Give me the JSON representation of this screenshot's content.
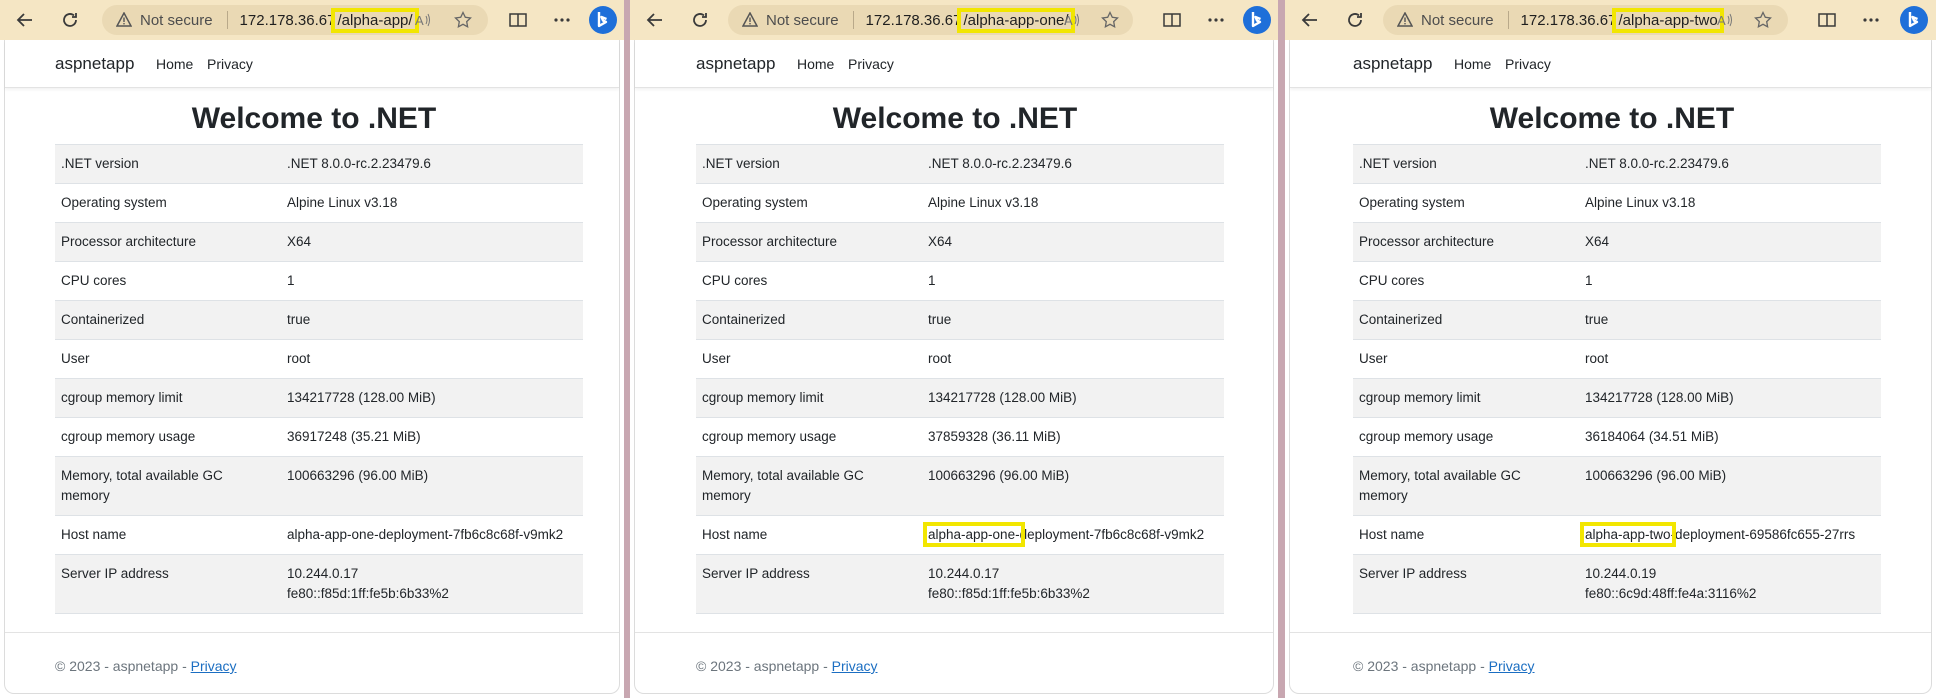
{
  "browser": {
    "not_secure": "Not secure",
    "windows": [
      {
        "host": "172.178.36.67",
        "path": "/alpha-app/"
      },
      {
        "host": "172.178.36.67",
        "path": "/alpha-app-one/"
      },
      {
        "host": "172.178.36.67",
        "path": "/alpha-app-two"
      }
    ]
  },
  "app": {
    "brand": "aspnetapp",
    "nav": [
      "Home",
      "Privacy"
    ],
    "title": "Welcome to .NET",
    "footer_prefix": "© 2023 - aspnetapp - ",
    "footer_link": "Privacy"
  },
  "labels": [
    ".NET version",
    "Operating system",
    "Processor architecture",
    "CPU cores",
    "Containerized",
    "User",
    "cgroup memory limit",
    "cgroup memory usage",
    "Memory, total available GC memory",
    "Host name",
    "Server IP address"
  ],
  "pages": [
    {
      "values": [
        ".NET 8.0.0-rc.2.23479.6",
        "Alpine Linux v3.18",
        "X64",
        "1",
        "true",
        "root",
        "134217728 (128.00 MiB)",
        "36917248 (35.21 MiB)",
        "100663296 (96.00 MiB)",
        "alpha-app-one-deployment-7fb6c8c68f-v9mk2",
        "10.244.0.17 fe80::f85d:1ff:fe5b:6b33%2"
      ],
      "host_hl": "",
      "host_rest": "alpha-app-one-deployment-7fb6c8c68f-v9mk2",
      "ip_line1": "10.244.0.17",
      "ip_line2": "fe80::f85d:1ff:fe5b:6b33%2"
    },
    {
      "values": [
        ".NET 8.0.0-rc.2.23479.6",
        "Alpine Linux v3.18",
        "X64",
        "1",
        "true",
        "root",
        "134217728 (128.00 MiB)",
        "37859328 (36.11 MiB)",
        "100663296 (96.00 MiB)",
        "alpha-app-one-deployment-7fb6c8c68f-v9mk2",
        "10.244.0.17 fe80::f85d:1ff:fe5b:6b33%2"
      ],
      "host_hl": "alpha-app-one-",
      "host_rest": "deployment-7fb6c8c68f-v9mk2",
      "ip_line1": "10.244.0.17",
      "ip_line2": "fe80::f85d:1ff:fe5b:6b33%2"
    },
    {
      "values": [
        ".NET 8.0.0-rc.2.23479.6",
        "Alpine Linux v3.18",
        "X64",
        "1",
        "true",
        "root",
        "134217728 (128.00 MiB)",
        "36184064 (34.51 MiB)",
        "100663296 (96.00 MiB)",
        "alpha-app-two-deployment-69586fc655-27rrs",
        "10.244.0.19 fe80::6c9d:48ff:fe4a:3116%2"
      ],
      "host_hl": "alpha-app-two",
      "host_rest": "-deployment-69586fc655-27rrs",
      "ip_line1": "10.244.0.19",
      "ip_line2": "fe80::6c9d:48ff:fe4a:3116%2"
    }
  ]
}
